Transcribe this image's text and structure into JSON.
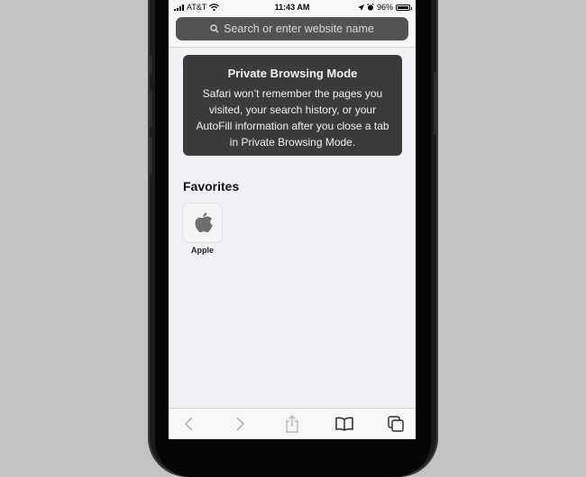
{
  "status_bar": {
    "carrier": "AT&T",
    "time": "11:43 AM",
    "battery_percent": "96%",
    "battery_level": 0.96,
    "icons": [
      "signal-icon",
      "wifi-icon",
      "location-icon",
      "alarm-icon",
      "battery-icon"
    ]
  },
  "address_bar": {
    "placeholder": "Search or enter website name",
    "icon": "search-icon"
  },
  "private_mode": {
    "title": "Private Browsing Mode",
    "body": "Safari won’t remember the pages you visited, your search history, or your AutoFill information after you close a tab in Private Browsing Mode."
  },
  "favorites": {
    "heading": "Favorites",
    "items": [
      {
        "label": "Apple",
        "icon": "apple-logo-icon"
      }
    ]
  },
  "toolbar": {
    "buttons": [
      "back-icon",
      "forward-icon",
      "share-icon",
      "bookmarks-icon",
      "tabs-icon"
    ]
  },
  "colors": {
    "background": "#c3c3c3",
    "screen": "#f2f1f6",
    "address_bar": "#525252",
    "private_card": "#3b3b3b",
    "toolbar_icon_disabled": "#b7b7b7"
  }
}
